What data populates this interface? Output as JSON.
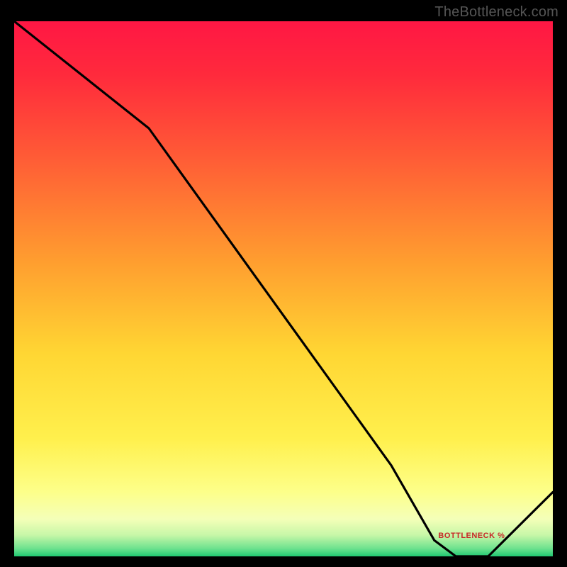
{
  "watermark": "TheBottleneck.com",
  "chart_data": {
    "type": "line",
    "title": "",
    "xlabel": "",
    "ylabel": "",
    "xlim": [
      0,
      100
    ],
    "ylim": [
      0,
      100
    ],
    "grid": false,
    "legend_position": "none",
    "x": [
      0,
      10,
      25,
      40,
      55,
      70,
      78,
      82,
      88,
      100
    ],
    "series": [
      {
        "name": "BOTTLENECK %",
        "values": [
          100,
          92,
          80,
          59,
          38,
          17,
          3,
          0,
          0,
          12
        ]
      }
    ],
    "annotation_position": {
      "x": 84,
      "y": 3
    },
    "gradient_stops": [
      {
        "offset": 0.0,
        "color": "#ff1744"
      },
      {
        "offset": 0.1,
        "color": "#ff2a3c"
      },
      {
        "offset": 0.25,
        "color": "#ff5a36"
      },
      {
        "offset": 0.45,
        "color": "#ff9e2f"
      },
      {
        "offset": 0.62,
        "color": "#ffd633"
      },
      {
        "offset": 0.78,
        "color": "#fff04d"
      },
      {
        "offset": 0.88,
        "color": "#fdff8a"
      },
      {
        "offset": 0.93,
        "color": "#f4ffb8"
      },
      {
        "offset": 0.96,
        "color": "#c8f7a8"
      },
      {
        "offset": 0.985,
        "color": "#6fe28f"
      },
      {
        "offset": 1.0,
        "color": "#1fc972"
      }
    ]
  }
}
